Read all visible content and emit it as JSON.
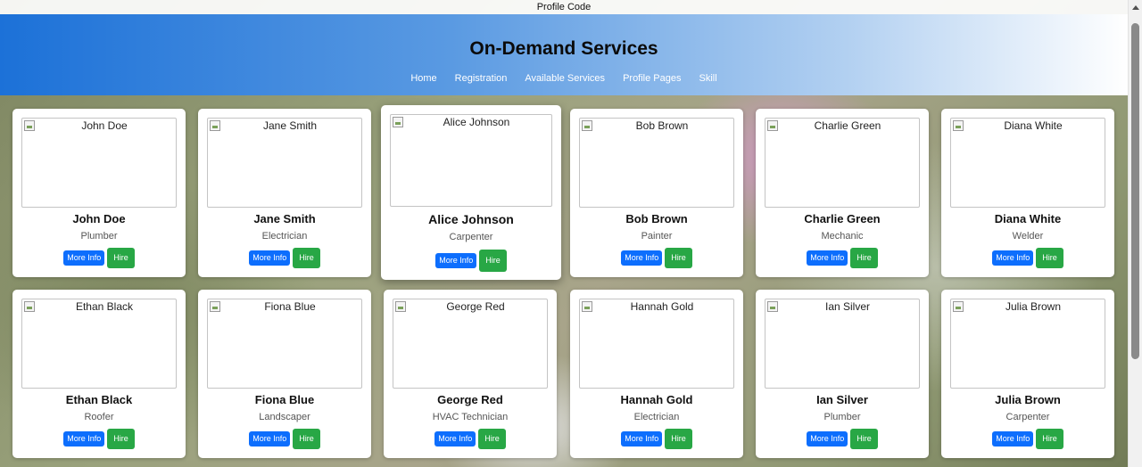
{
  "topbar": {
    "text": "Profile Code"
  },
  "header": {
    "title": "On-Demand Services",
    "nav": [
      {
        "label": "Home"
      },
      {
        "label": "Registration"
      },
      {
        "label": "Available Services"
      },
      {
        "label": "Profile Pages"
      },
      {
        "label": "Skill"
      }
    ]
  },
  "buttons": {
    "more_info": "More Info",
    "hire": "Hire"
  },
  "colors": {
    "header_start": "#1c71d8",
    "info_button": "#0d6efd",
    "hire_button": "#28a745"
  },
  "profiles": [
    {
      "alt": "John Doe",
      "name": "John Doe",
      "role": "Plumber"
    },
    {
      "alt": "Jane Smith",
      "name": "Jane Smith",
      "role": "Electrician"
    },
    {
      "alt": "Alice Johnson",
      "name": "Alice Johnson",
      "role": "Carpenter"
    },
    {
      "alt": "Bob Brown",
      "name": "Bob Brown",
      "role": "Painter"
    },
    {
      "alt": "Charlie Green",
      "name": "Charlie Green",
      "role": "Mechanic"
    },
    {
      "alt": "Diana White",
      "name": "Diana White",
      "role": "Welder"
    },
    {
      "alt": "Ethan Black",
      "name": "Ethan Black",
      "role": "Roofer"
    },
    {
      "alt": "Fiona Blue",
      "name": "Fiona Blue",
      "role": "Landscaper"
    },
    {
      "alt": "George Red",
      "name": "George Red",
      "role": "HVAC Technician"
    },
    {
      "alt": "Hannah Gold",
      "name": "Hannah Gold",
      "role": "Electrician"
    },
    {
      "alt": "Ian Silver",
      "name": "Ian Silver",
      "role": "Plumber"
    },
    {
      "alt": "Julia Brown",
      "name": "Julia Brown",
      "role": "Carpenter"
    }
  ]
}
